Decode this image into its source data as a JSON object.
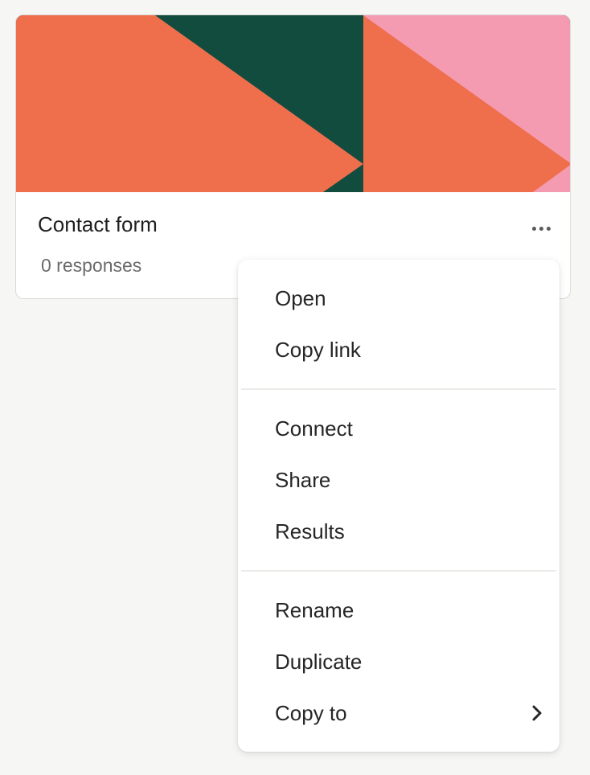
{
  "card": {
    "title": "Contact form",
    "responses": "0 responses",
    "cover_colors": {
      "orange": "#ef6f4d",
      "dark_green": "#124c3e",
      "pink": "#f49bb2"
    },
    "more_icon": "more-horizontal-icon"
  },
  "menu": {
    "items": [
      {
        "label": "Open"
      },
      {
        "label": "Copy link"
      },
      {
        "label": "Connect"
      },
      {
        "label": "Share"
      },
      {
        "label": "Results"
      },
      {
        "label": "Rename"
      },
      {
        "label": "Duplicate"
      },
      {
        "label": "Copy to",
        "icon": "chevron-right-icon"
      }
    ]
  }
}
